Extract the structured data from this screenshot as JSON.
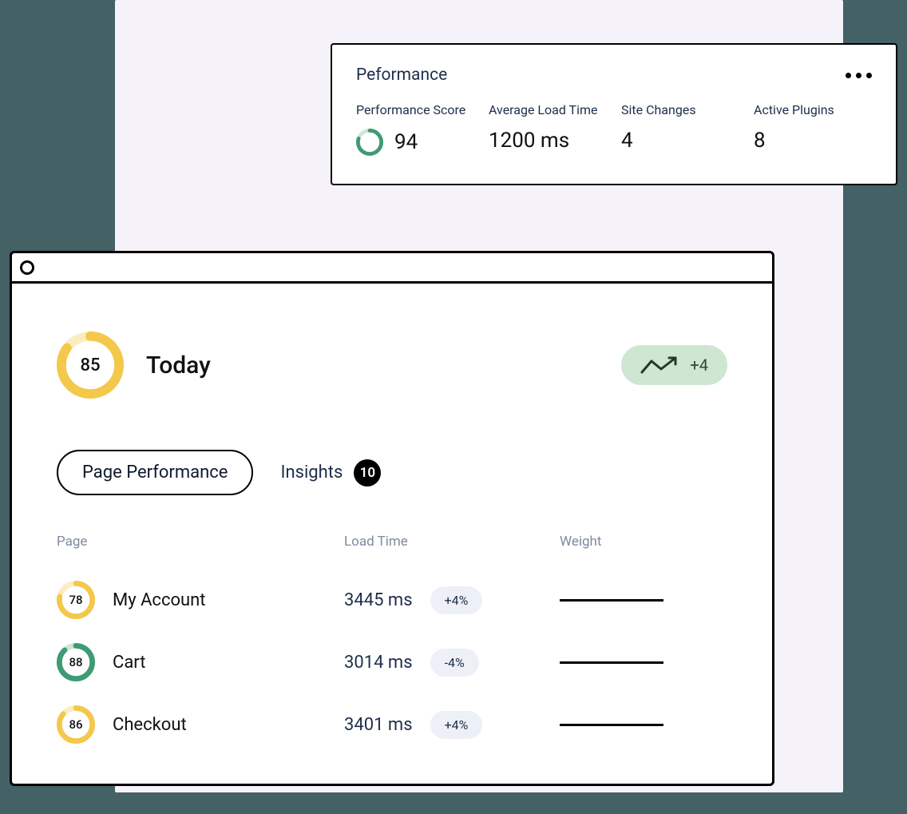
{
  "colors": {
    "ring_yellow_light": "#fcecc0",
    "ring_yellow": "#f3c84b",
    "ring_green_light": "#cfe6d2",
    "ring_green": "#3e9b74"
  },
  "performance_card": {
    "title": "Peformance",
    "stats": {
      "score": {
        "label": "Performance Score",
        "value": "94",
        "ring_pct": 80,
        "ring_color": "green"
      },
      "load": {
        "label": "Average Load Time",
        "value": "1200 ms"
      },
      "changes": {
        "label": "Site Changes",
        "value": "4"
      },
      "plugins": {
        "label": "Active Plugins",
        "value": "8"
      }
    }
  },
  "main": {
    "today": {
      "score": "85",
      "score_ring_pct": 85,
      "label": "Today",
      "trend_delta": "+4"
    },
    "tabs": {
      "page_performance": "Page Performance",
      "insights_label": "Insights",
      "insights_count": "10"
    },
    "table": {
      "columns": {
        "page": "Page",
        "load": "Load Time",
        "weight": "Weight"
      },
      "rows": [
        {
          "score": "78",
          "ring_pct": 78,
          "ring_color": "yellow",
          "name": "My Account",
          "load": "3445 ms",
          "delta": "+4%"
        },
        {
          "score": "88",
          "ring_pct": 88,
          "ring_color": "green",
          "name": "Cart",
          "load": "3014 ms",
          "delta": "-4%"
        },
        {
          "score": "86",
          "ring_pct": 86,
          "ring_color": "yellow",
          "name": "Checkout",
          "load": "3401 ms",
          "delta": "+4%"
        }
      ]
    }
  }
}
